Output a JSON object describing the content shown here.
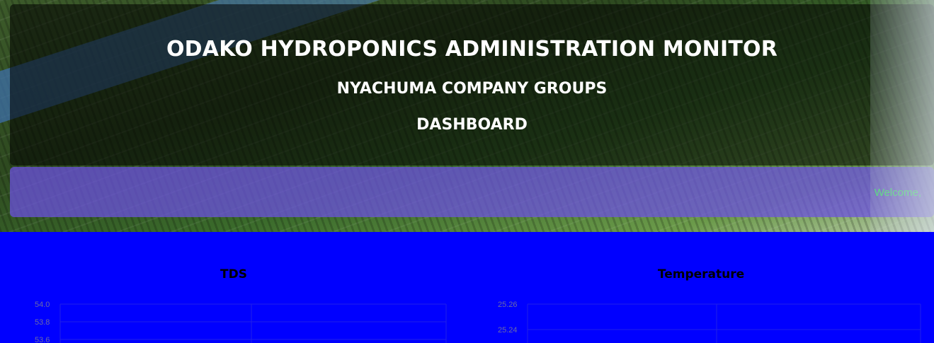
{
  "header": {
    "title": "ODAKO HYDROPONICS ADMINISTRATION MONITOR",
    "subtitle": "NYACHUMA COMPANY GROUPS",
    "page": "DASHBOARD"
  },
  "welcome": {
    "text": "Welcome,"
  },
  "colors": {
    "panel_bg": "#0000ff",
    "welcome_text": "#3ee06a",
    "welcome_bar": "#6e50e6"
  },
  "chart_data": [
    {
      "type": "line",
      "title": "TDS",
      "yticks": [
        "54.0",
        "53.8",
        "53.6"
      ]
    },
    {
      "type": "line",
      "title": "Temperature",
      "yticks": [
        "25.26",
        "25.24"
      ]
    }
  ]
}
